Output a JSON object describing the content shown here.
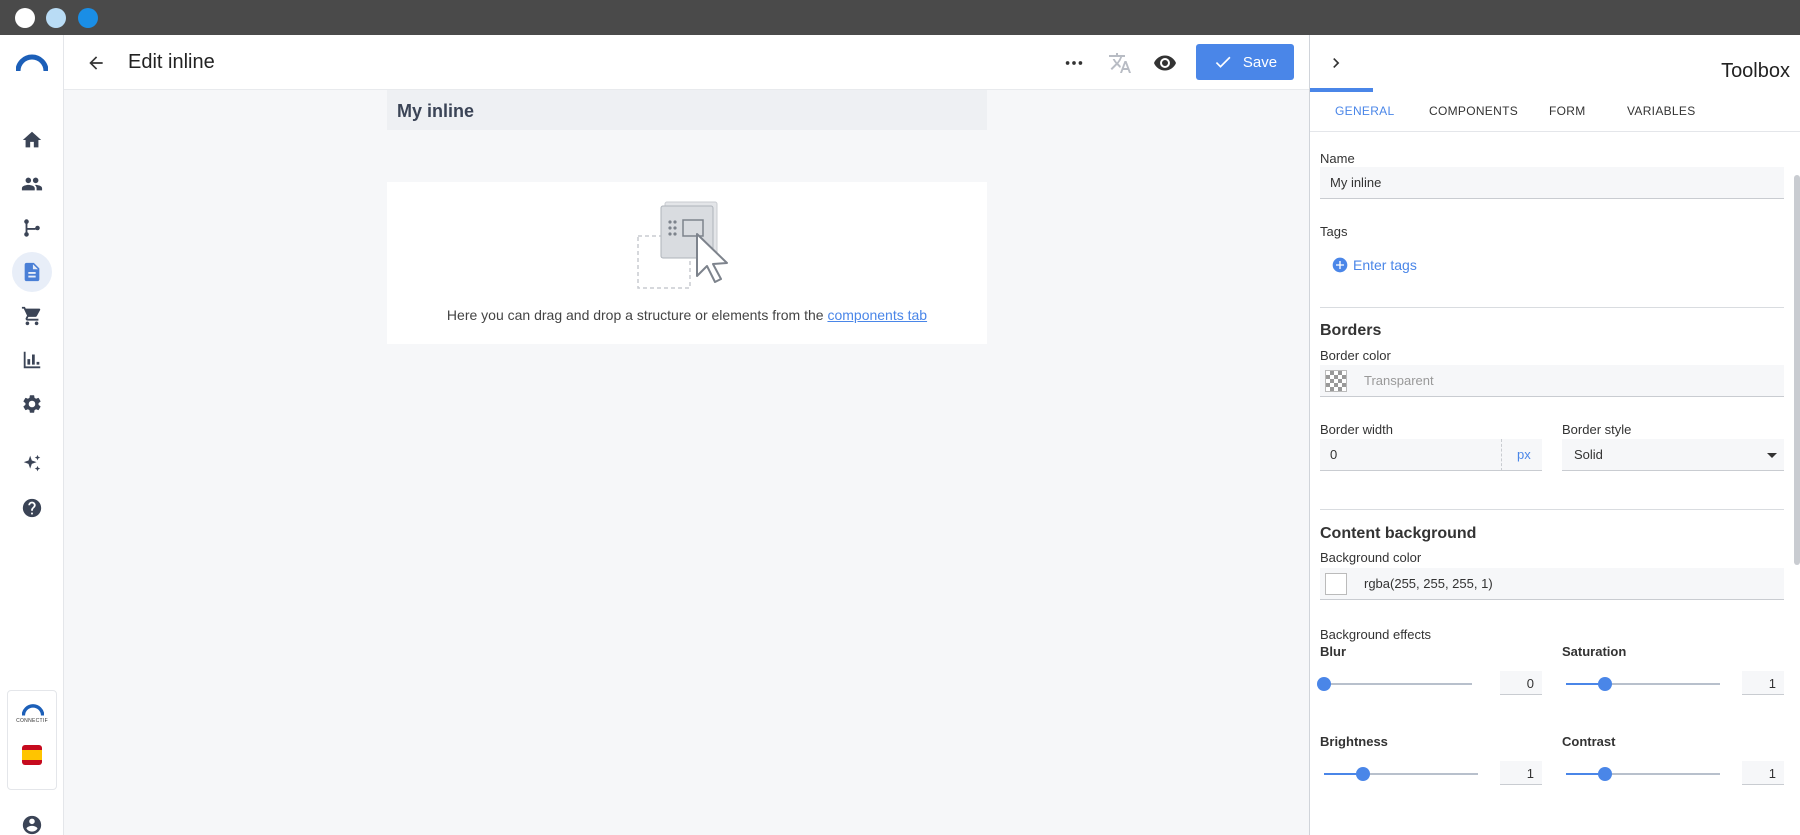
{
  "colors": {
    "accent": "#4a86e8",
    "titlebar": "#4a4a4a",
    "traffic": [
      "#ffffff",
      "#b9dcf5",
      "#1a8ee6"
    ]
  },
  "nav": {
    "items": [
      {
        "icon": "home-icon"
      },
      {
        "icon": "users-icon"
      },
      {
        "icon": "flow-icon"
      },
      {
        "icon": "document-icon",
        "active": true
      },
      {
        "icon": "cart-icon"
      },
      {
        "icon": "bar-chart-icon"
      },
      {
        "icon": "gear-icon"
      },
      {
        "icon": "sparkle-icon"
      },
      {
        "icon": "help-icon"
      }
    ],
    "brand_text": "CONNECTIF"
  },
  "header": {
    "title": "Edit inline",
    "save_label": "Save"
  },
  "canvas": {
    "inline_name": "My inline",
    "drop_text": "Here you can drag and drop a structure or elements from the",
    "drop_link": "components tab"
  },
  "toolbox": {
    "title": "Toolbox",
    "tabs": [
      {
        "label": "GENERAL",
        "active": true
      },
      {
        "label": "COMPONENTS"
      },
      {
        "label": "FORM"
      },
      {
        "label": "VARIABLES"
      }
    ],
    "name_label": "Name",
    "name_value": "My inline",
    "tags_label": "Tags",
    "tags_button": "Enter tags",
    "borders_title": "Borders",
    "border_color_label": "Border color",
    "border_color_value": "Transparent",
    "border_width_label": "Border width",
    "border_width_value": "0",
    "border_width_unit": "px",
    "border_style_label": "Border style",
    "border_style_value": "Solid",
    "content_bg_title": "Content background",
    "bg_color_label": "Background color",
    "bg_color_value": "rgba(255, 255, 255, 1)",
    "bg_effects_label": "Background effects",
    "blur": {
      "label": "Blur",
      "value": "0",
      "fraction": 0.0
    },
    "saturation": {
      "label": "Saturation",
      "value": "1",
      "fraction": 0.25
    },
    "brightness": {
      "label": "Brightness",
      "value": "1",
      "fraction": 0.25
    },
    "contrast": {
      "label": "Contrast",
      "value": "1",
      "fraction": 0.25
    }
  }
}
